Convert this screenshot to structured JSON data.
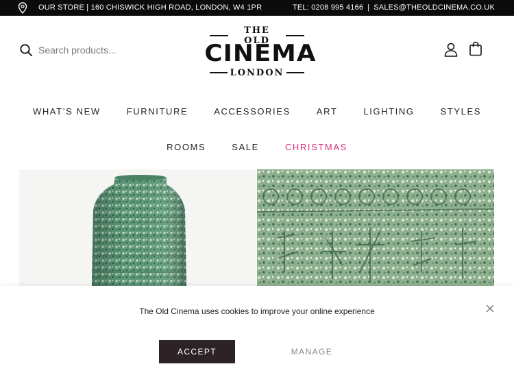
{
  "topbar": {
    "store_text": "OUR STORE | 160 CHISWICK HIGH ROAD, LONDON, W4 1PR",
    "tel_text": "TEL: 0208 995 4166",
    "separator": "|",
    "email_text": "SALES@THEOLDCINEMA.CO.UK",
    "pin_icon": "map-pin-icon"
  },
  "header": {
    "search_placeholder": "Search products...",
    "logo": {
      "line_top": "THE OLD",
      "line_main": "CINEMA",
      "line_bottom": "LONDON"
    },
    "icons": [
      "search-icon",
      "user-icon",
      "shopping-bag-icon"
    ]
  },
  "nav": {
    "row1": [
      "WHAT’S NEW",
      "FURNITURE",
      "ACCESSORIES",
      "ART",
      "LIGHTING",
      "STYLES"
    ],
    "row2": [
      "ROOMS",
      "SALE",
      "CHRISTMAS"
    ],
    "highlight_color": "#d62f7f"
  },
  "cookie": {
    "message": "The Old Cinema uses cookies to improve your online experience",
    "accept_label": "ACCEPT",
    "manage_label": "MANAGE",
    "close_icon": "close-icon"
  },
  "colors": {
    "topbar_bg": "#0b0b0b",
    "accept_bg": "#2d2326",
    "vase_green": "#5f9a7a"
  }
}
